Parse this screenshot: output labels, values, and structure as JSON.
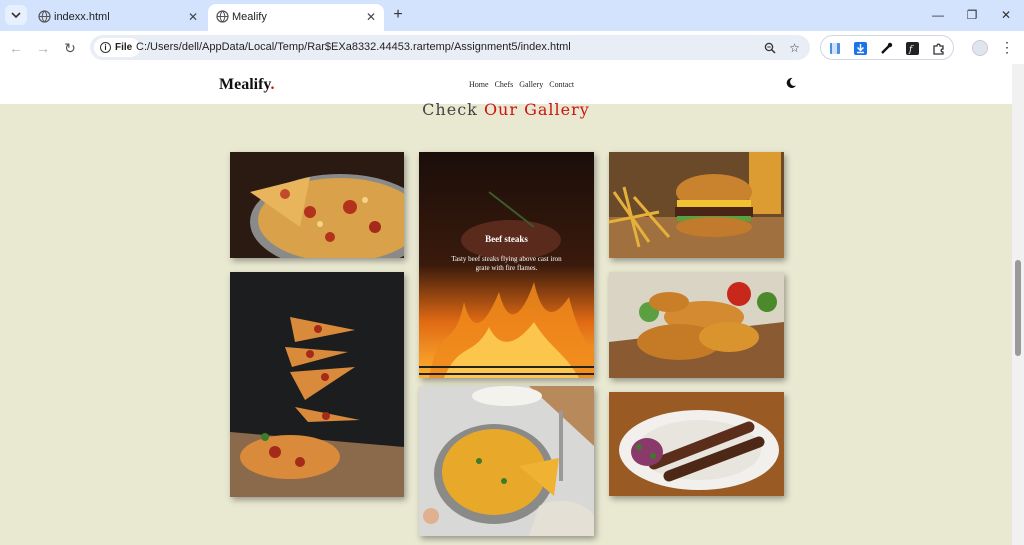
{
  "browser": {
    "tabs": [
      {
        "title": "indexx.html",
        "active": false
      },
      {
        "title": "Mealify",
        "active": true
      }
    ],
    "url": "C:/Users/dell/AppData/Local/Temp/Rar$EXa8332.44453.rartemp/Assignment5/index.html",
    "site_chip": "File"
  },
  "site": {
    "logo": "Mealify",
    "logo_dot": ".",
    "nav": [
      "Home",
      "Chefs",
      "Gallery",
      "Contact"
    ],
    "section_title_a": "Check ",
    "section_title_b": "Our Gallery",
    "hover_title": "Beef steaks",
    "hover_desc": "Tasty beef steaks flying above cast iron grate with fire flames."
  },
  "colors": {
    "accent": "#ce1212",
    "page_bg": "#e9e8d1"
  },
  "gallery": [
    "pizza-photo",
    "beef-steak-fire-photo",
    "burger-fries-photo",
    "flying-pizza-slices-photo",
    "fried-chicken-photo",
    "omelette-pan-photo",
    "kebab-plate-photo"
  ]
}
